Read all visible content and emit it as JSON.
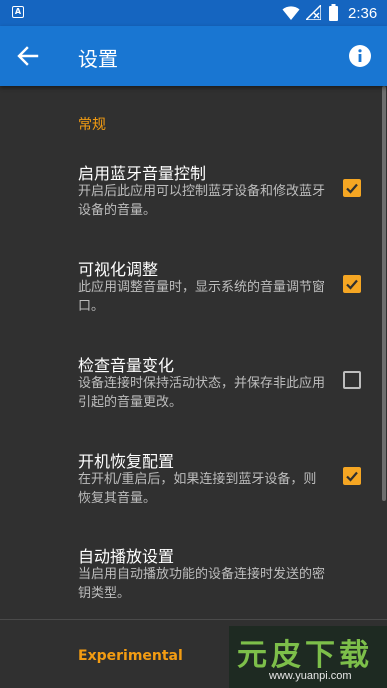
{
  "status_bar": {
    "notification_icon": "a-box-icon",
    "time": "2:36"
  },
  "toolbar": {
    "title": "设置",
    "back_icon": "arrow-left-icon",
    "info_icon": "info-icon"
  },
  "sections": {
    "general": {
      "header": "常规"
    },
    "experimental": {
      "header": "Experimental"
    }
  },
  "preferences": [
    {
      "title": "启用蓝牙音量控制",
      "summary": "开启后此应用可以控制蓝牙设备和修改蓝牙设备的音量。",
      "checked": true
    },
    {
      "title": "可视化调整",
      "summary": "此应用调整音量时，显示系统的音量调节窗口。",
      "checked": true
    },
    {
      "title": "检查音量变化",
      "summary": "设备连接时保持活动状态，并保存非此应用引起的音量更改。",
      "checked": false
    },
    {
      "title": "开机恢复配置",
      "summary": "在开机/重启后，如果连接到蓝牙设备，则恢复其音量。",
      "checked": true
    },
    {
      "title": "自动播放设置",
      "summary": "当启用自动播放功能的设备连接时发送的密钥类型。"
    }
  ],
  "watermark": {
    "text": "元皮下载",
    "url": "www.yuanpi.com"
  },
  "colors": {
    "status_bar": "#1565C0",
    "toolbar": "#1976D2",
    "background": "#303030",
    "accent": "#F5A623",
    "section_header": "#F39C12"
  }
}
